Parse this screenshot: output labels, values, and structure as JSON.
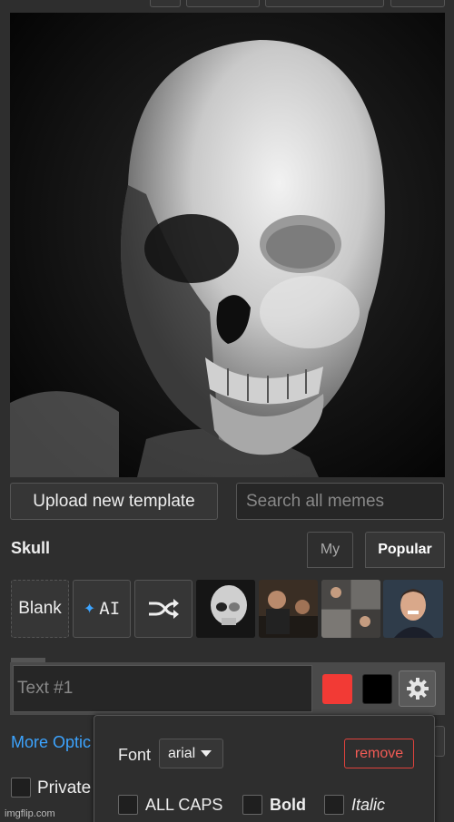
{
  "template": {
    "name": "Skull"
  },
  "actions": {
    "upload_label": "Upload new template"
  },
  "search": {
    "placeholder": "Search all memes"
  },
  "tabs": [
    {
      "label": "My",
      "active": false
    },
    {
      "label": "Popular",
      "active": true
    }
  ],
  "tiles": {
    "blank_label": "Blank",
    "ai_label": "AI",
    "shuffle_icon": "shuffle-icon",
    "thumbnails": [
      "skull",
      "scene-1",
      "scene-2",
      "man-grinning"
    ]
  },
  "text_box": {
    "placeholder": "Text #1",
    "color": "#f23a35",
    "outline_color": "#000000"
  },
  "more_options_label": "More Optic",
  "font_popover": {
    "font_label": "Font",
    "font_value": "arial",
    "remove_label": "remove",
    "options": [
      {
        "label": "ALL CAPS"
      },
      {
        "label": "Bold"
      },
      {
        "label": "Italic"
      }
    ]
  },
  "private_label": "Private",
  "watermark": "imgflip.com",
  "colors": {
    "accent_link": "#3ca4ff",
    "remove": "#e0423c",
    "background": "#2e2e2e"
  }
}
